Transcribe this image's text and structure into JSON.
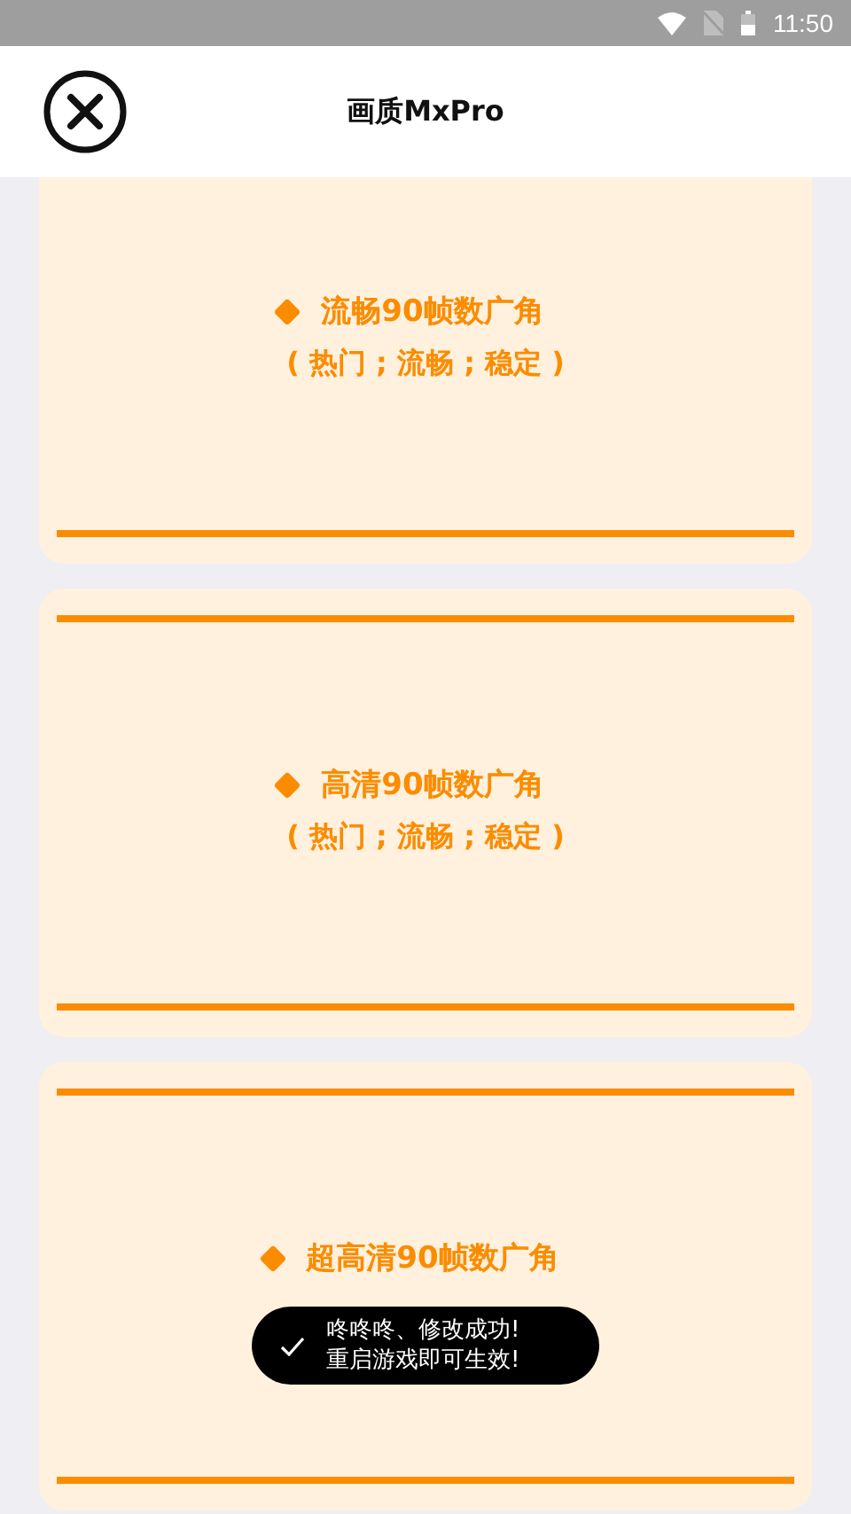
{
  "status_bar": {
    "time": "11:50"
  },
  "header": {
    "title": "画质MxPro"
  },
  "options": [
    {
      "title": "流畅90帧数广角",
      "subtitle": "( 热门 ; 流畅 ; 稳定 )"
    },
    {
      "title": "高清90帧数广角",
      "subtitle": "( 热门 ; 流畅 ; 稳定 )"
    },
    {
      "title": "超高清90帧数广角"
    }
  ],
  "toast": {
    "lines": [
      "咚咚咚、修改成功!",
      "重启游戏即可生效!"
    ]
  }
}
